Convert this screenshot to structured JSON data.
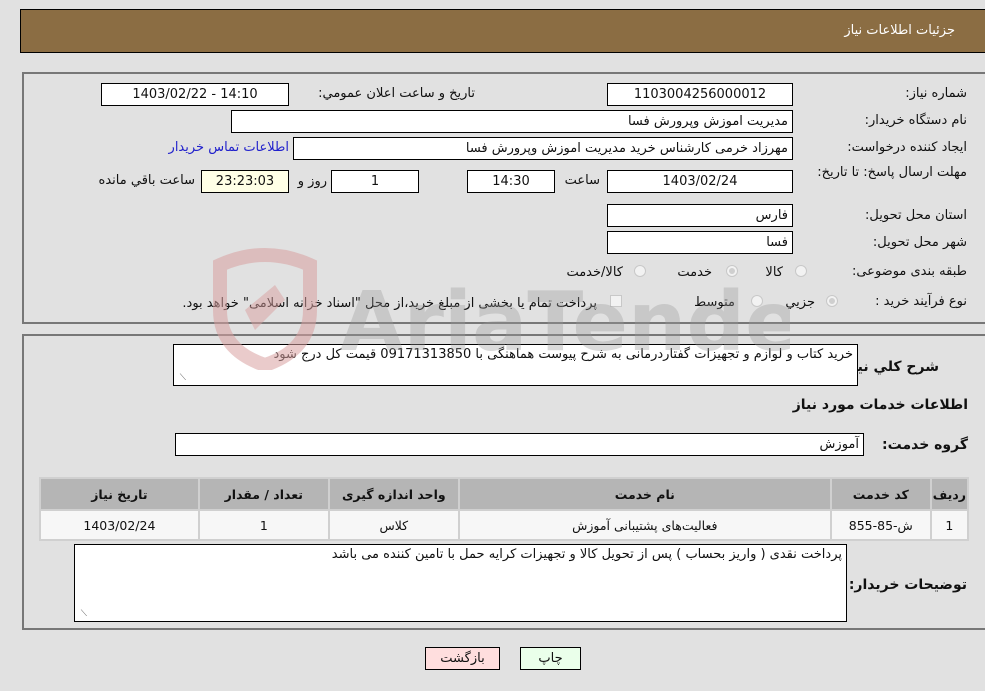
{
  "header": {
    "title": "جزئیات اطلاعات نیاز"
  },
  "details": {
    "need_number_label": "شماره نیاز:",
    "need_number": "1103004256000012",
    "announce_label": "تاریخ و ساعت اعلان عمومي:",
    "announce_value": "1403/02/22 - 14:10",
    "buyer_org_label": "نام دستگاه خریدار:",
    "buyer_org": "مدیریت اموزش وپرورش فسا",
    "creator_label": "ایجاد کننده درخواست:",
    "creator": "مهرزاد خرمی کارشناس خرید مدیریت اموزش وپرورش فسا",
    "contact_link": "اطلاعات تماس خریدار",
    "deadline_label": "مهلت ارسال پاسخ: تا تاریخ:",
    "deadline_date": "1403/02/24",
    "time_label": "ساعت",
    "deadline_time": "14:30",
    "days_value": "1",
    "days_label": "روز و",
    "remaining_value": "23:23:03",
    "remaining_label": "ساعت باقي مانده",
    "province_label": "استان محل تحویل:",
    "province": "فارس",
    "city_label": "شهر محل تحویل:",
    "city": "فسا",
    "category_label": "طبقه بندی موضوعی:",
    "category_options": [
      {
        "label": "کالا",
        "selected": false
      },
      {
        "label": "خدمت",
        "selected": true
      },
      {
        "label": "کالا/خدمت",
        "selected": false
      }
    ],
    "process_label": "نوع فرآیند خرید :",
    "process_options": [
      {
        "label": "جزيي",
        "selected": true
      },
      {
        "label": "متوسط",
        "selected": false
      }
    ],
    "treasury_note": "پرداخت تمام یا بخشی از مبلغ خرید،از محل \"اسناد خزانه اسلامی\" خواهد بود."
  },
  "summary": {
    "label": "شرح کلي نیاز:",
    "value": "خرید کتاب و لوازم و تجهیزات گفتاردرمانی به شرح پیوست هماهنگی با 09171313850 قیمت کل درج شود"
  },
  "services": {
    "section_title": "اطلاعات خدمات مورد نیاز",
    "group_label": "گروه خدمت:",
    "group_value": "آموزش",
    "columns": [
      "ردیف",
      "کد خدمت",
      "نام خدمت",
      "واحد اندازه گیری",
      "تعداد / مقدار",
      "تاریخ نیاز"
    ],
    "rows": [
      [
        "1",
        "ش-85-855",
        "فعالیت‌های پشتیبانی آموزش",
        "کلاس",
        "1",
        "1403/02/24"
      ]
    ]
  },
  "buyer_notes": {
    "label": "توضیحات خریدار:",
    "value": "پرداخت نقدی ( واریز بحساب ) پس از تحویل کالا و تجهیزات کرایه حمل با تامین کننده می باشد"
  },
  "buttons": {
    "print": "چاپ",
    "back": "بازگشت"
  },
  "colors": {
    "header": "#8b6d43",
    "print_bg": "#eaffea",
    "back_bg": "#ffdede",
    "link": "#2222cc"
  },
  "watermark": {
    "text": "AriaTender.neT"
  }
}
